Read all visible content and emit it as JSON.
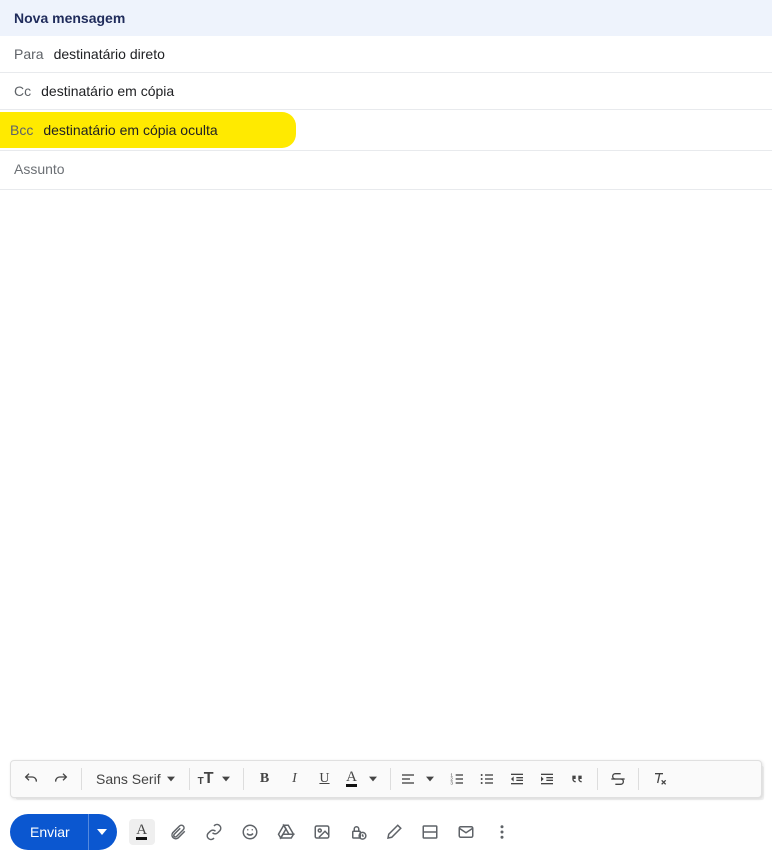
{
  "header": {
    "title": "Nova mensagem"
  },
  "recipients": {
    "to_label": "Para",
    "to_value": "destinatário direto",
    "cc_label": "Cc",
    "cc_value": "destinatário em cópia",
    "bcc_label": "Bcc",
    "bcc_value": "destinatário em cópia oculta"
  },
  "subject": {
    "placeholder": "Assunto",
    "value": ""
  },
  "body": {
    "value": ""
  },
  "format_toolbar": {
    "font_name": "Sans Serif"
  },
  "actions": {
    "send_label": "Enviar"
  }
}
